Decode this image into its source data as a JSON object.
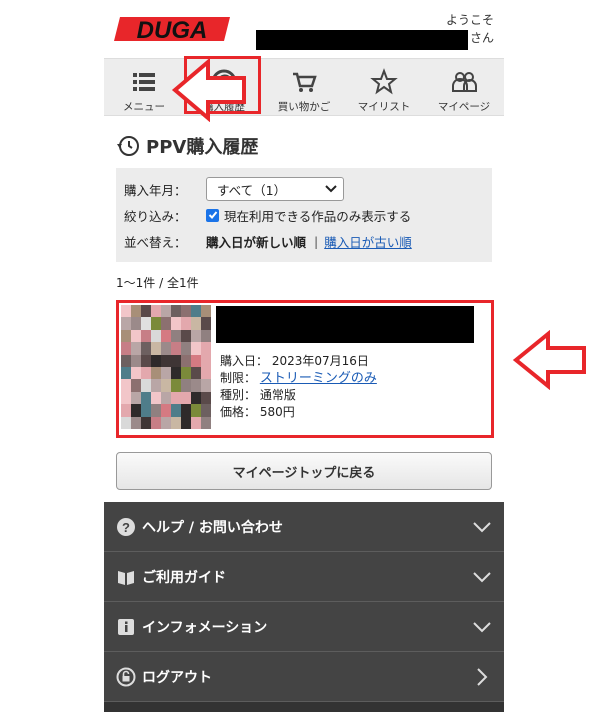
{
  "header": {
    "logo_text": "DUGA",
    "welcome_prefix": "ようこそ",
    "welcome_suffix": "さん"
  },
  "nav": [
    {
      "label": "メニュー",
      "icon": "menu-icon"
    },
    {
      "label": "購入履歴",
      "icon": "history-icon"
    },
    {
      "label": "買い物かご",
      "icon": "cart-icon"
    },
    {
      "label": "マイリスト",
      "icon": "star-icon"
    },
    {
      "label": "マイページ",
      "icon": "users-icon"
    }
  ],
  "page_title": "PPV購入履歴",
  "filter": {
    "year_label": "購入年月：",
    "year_selected": "すべて（1）",
    "narrow_label": "絞り込み：",
    "narrow_option": "現在利用できる作品のみ表示する",
    "sort_label": "並べ替え：",
    "sort_active": "購入日が新しい順",
    "sort_sep": "|",
    "sort_link": "購入日が古い順"
  },
  "count_text": "1～1件 / 全1件",
  "item": {
    "date_label": "購入日：",
    "date_value": "2023年07月16日",
    "limit_label": "制限：",
    "limit_value": "ストリーミングのみ",
    "type_label": "種別：",
    "type_value": "通常版",
    "price_label": "価格：",
    "price_value": "580円"
  },
  "back_button": "マイページトップに戻る",
  "footer": [
    {
      "label": "ヘルプ / お問い合わせ",
      "icon": "help-icon",
      "chevron": "chevron-down-icon"
    },
    {
      "label": "ご利用ガイド",
      "icon": "guide-book-icon",
      "chevron": "chevron-down-icon"
    },
    {
      "label": "インフォメーション",
      "icon": "info-icon",
      "chevron": "chevron-down-icon"
    },
    {
      "label": "ログアウト",
      "icon": "logout-lock-icon",
      "chevron": "chevron-right-icon"
    }
  ],
  "colors": {
    "accent_red": "#e8262a",
    "link_blue": "#1a5bb5",
    "footer_bg": "#444444"
  }
}
